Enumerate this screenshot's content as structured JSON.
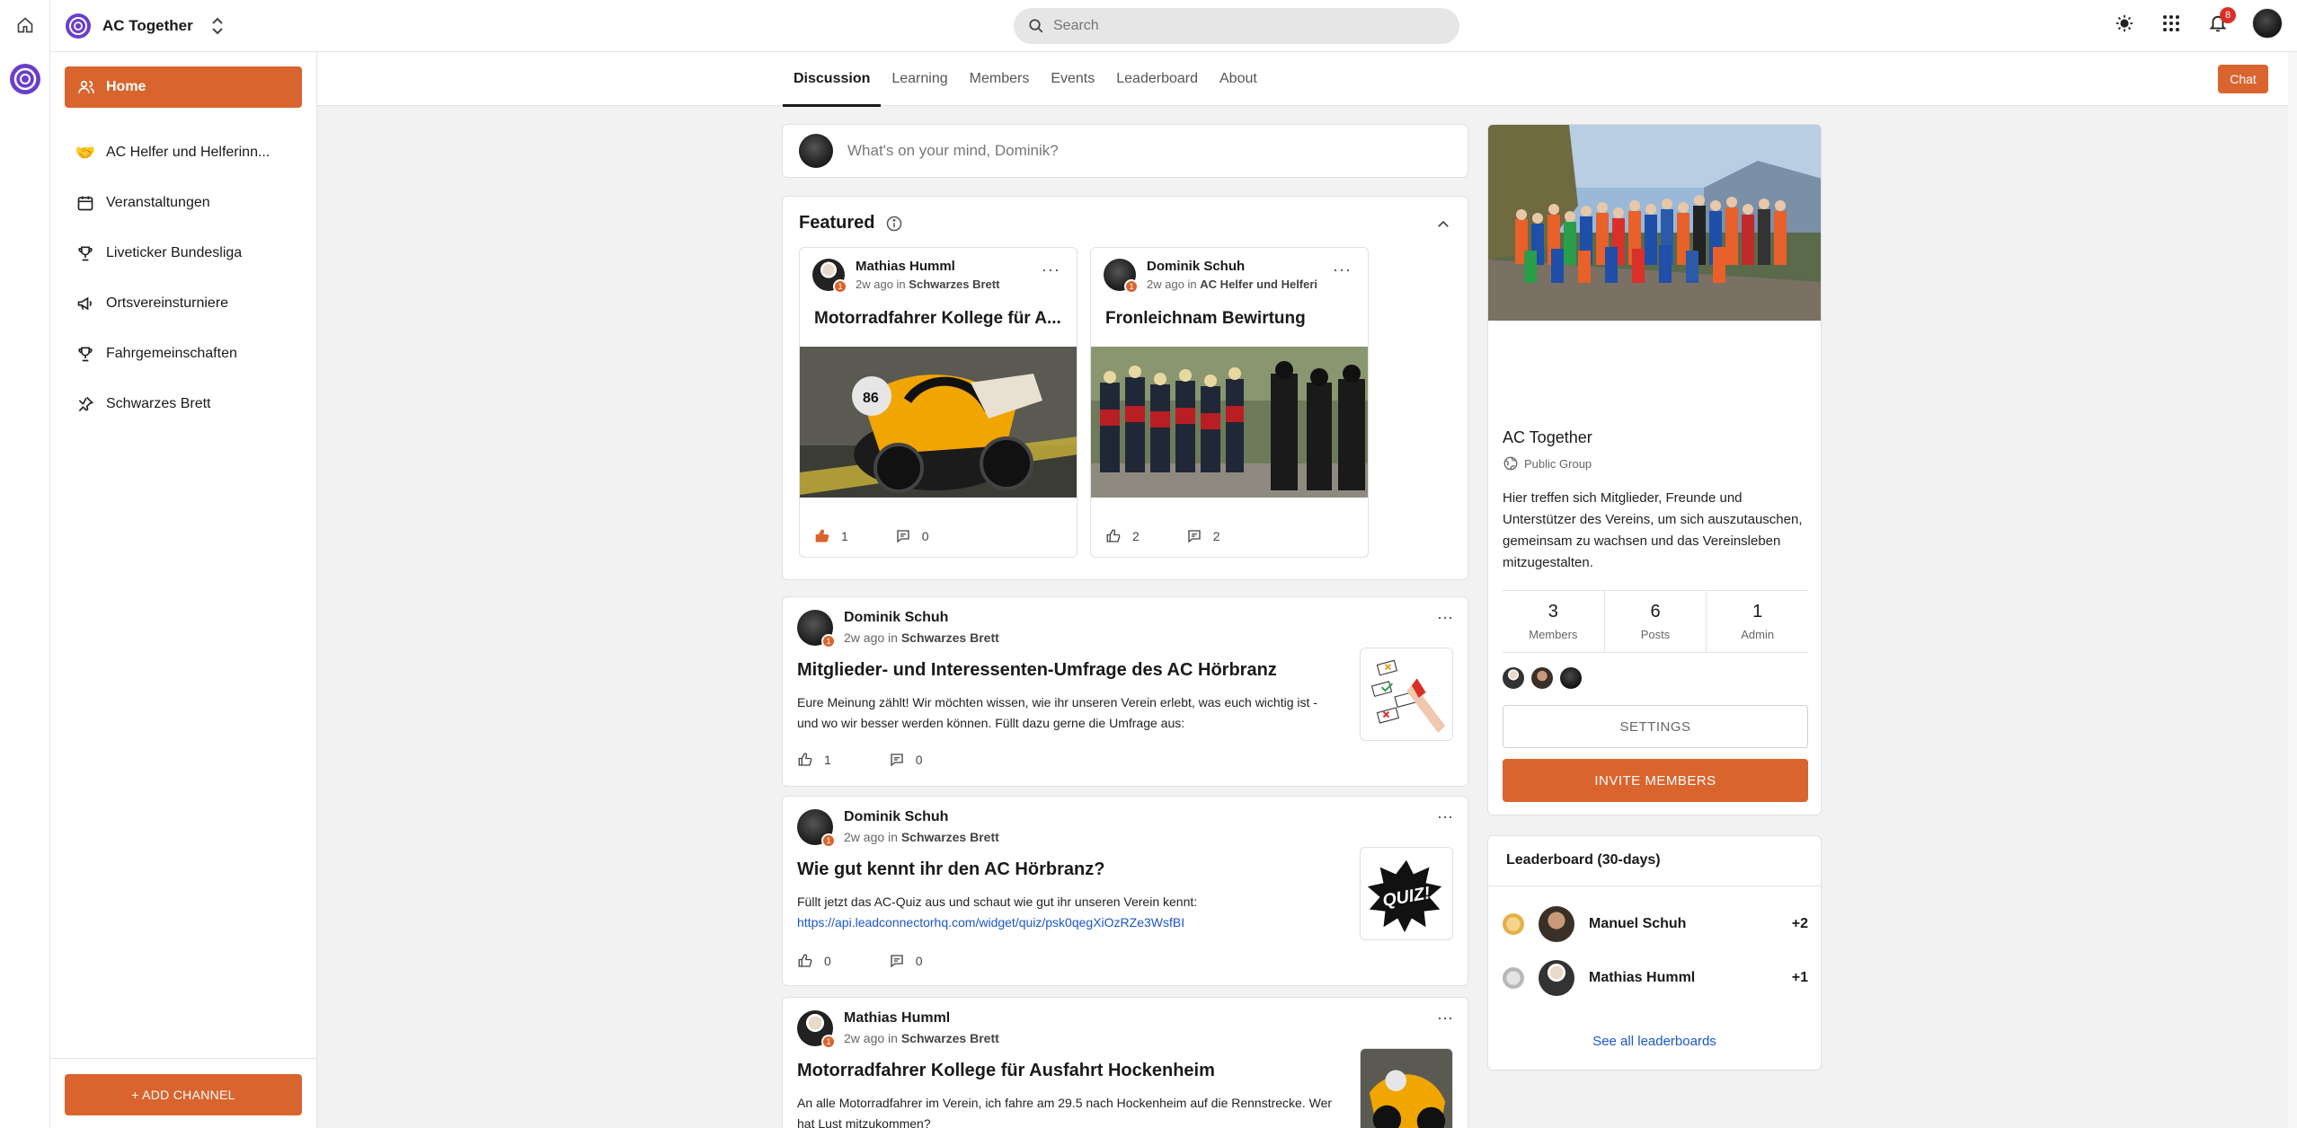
{
  "app": {
    "group_name": "AC Together"
  },
  "search": {
    "placeholder": "Search"
  },
  "notifications": {
    "count": "8"
  },
  "sidebar": {
    "home": "Home",
    "items": [
      {
        "label": "AC Helfer und Helferinn...",
        "icon": "handshake-icon"
      },
      {
        "label": "Veranstaltungen",
        "icon": "calendar-icon"
      },
      {
        "label": "Liveticker Bundesliga",
        "icon": "trophy-icon"
      },
      {
        "label": "Ortsvereinsturniere",
        "icon": "megaphone-icon"
      },
      {
        "label": "Fahrgemeinschaften",
        "icon": "trophy-icon"
      },
      {
        "label": "Schwarzes Brett",
        "icon": "pin-icon"
      }
    ],
    "add_channel": "+ ADD CHANNEL"
  },
  "tabs": [
    "Discussion",
    "Learning",
    "Members",
    "Events",
    "Leaderboard",
    "About"
  ],
  "chat_label": "Chat",
  "composer": {
    "placeholder": "What's on your mind, Dominik?"
  },
  "featured": {
    "title": "Featured",
    "cards": [
      {
        "author": "Mathias Humml",
        "time": "2w ago",
        "in": "in",
        "channel": "Schwarzes Brett",
        "title": "Motorradfahrer Kollege für A...",
        "likes": "1",
        "comments": "0"
      },
      {
        "author": "Dominik Schuh",
        "time": "2w ago",
        "in": "in",
        "channel": "AC Helfer und Helferi",
        "title": "Fronleichnam Bewirtung",
        "likes": "2",
        "comments": "2"
      }
    ]
  },
  "posts": [
    {
      "author": "Dominik Schuh",
      "time": "2w ago",
      "in": "in",
      "channel": "Schwarzes Brett",
      "title": "Mitglieder- und Interessenten-Umfrage des AC Hörbranz",
      "body": "Eure Meinung zählt! Wir möchten wissen, wie ihr unseren Verein erlebt, was euch wichtig ist - und wo wir besser werden können. Füllt dazu gerne die Umfrage aus:",
      "likes": "1",
      "comments": "0"
    },
    {
      "author": "Dominik Schuh",
      "time": "2w ago",
      "in": "in",
      "channel": "Schwarzes Brett",
      "title": "Wie gut kennt ihr den AC Hörbranz?",
      "body": "Füllt jetzt das AC-Quiz aus und schaut wie gut ihr unseren Verein kennt:",
      "link": "https://api.leadconnectorhq.com/widget/quiz/psk0qegXiOzRZe3WsfBI",
      "thumb_text": "QUIZ!",
      "likes": "0",
      "comments": "0"
    },
    {
      "author": "Mathias Humml",
      "time": "2w ago",
      "in": "in",
      "channel": "Schwarzes Brett",
      "title": "Motorradfahrer Kollege für Ausfahrt Hockenheim",
      "body": "An alle Motorradfahrer im Verein, ich fahre am 29.5 nach Hockenheim auf die Rennstrecke. Wer hat Lust mitzukommen?"
    }
  ],
  "group": {
    "name": "AC Together",
    "type": "Public Group",
    "description": "Hier treffen sich Mitglieder, Freunde und Unterstützer des Vereins, um sich auszutauschen, gemeinsam zu wachsen und das Vereinsleben mitzugestalten.",
    "stats": [
      {
        "value": "3",
        "label": "Members"
      },
      {
        "value": "6",
        "label": "Posts"
      },
      {
        "value": "1",
        "label": "Admin"
      }
    ],
    "settings": "SETTINGS",
    "invite": "INVITE MEMBERS"
  },
  "leaderboard": {
    "title": "Leaderboard (30-days)",
    "rows": [
      {
        "name": "Manuel Schuh",
        "points": "+2"
      },
      {
        "name": "Mathias Humml",
        "points": "+1"
      }
    ],
    "see_all": "See all leaderboards"
  },
  "colors": {
    "accent": "#d9642e",
    "link": "#1a56c8",
    "brand": "#6a3fc8"
  }
}
